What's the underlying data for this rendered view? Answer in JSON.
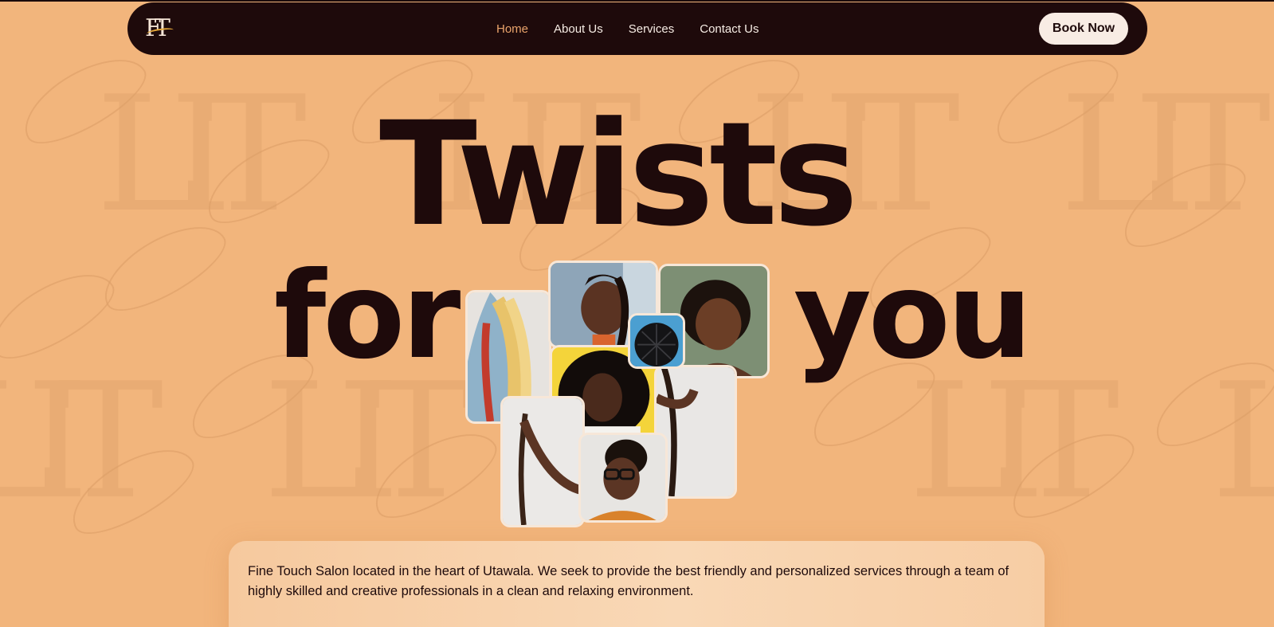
{
  "app": {
    "logo_text": "FT",
    "brand_colors": {
      "background": "#f2b57c",
      "nav": "#1e0a0b",
      "accent": "#e9a36b",
      "button_bg": "#f8ece4"
    }
  },
  "nav": {
    "links": [
      {
        "label": "Home",
        "active": true
      },
      {
        "label": "About Us",
        "active": false
      },
      {
        "label": "Services",
        "active": false
      },
      {
        "label": "Contact Us",
        "active": false
      }
    ],
    "book_label": "Book Now"
  },
  "hero": {
    "word_1": "Twists",
    "word_2": "for",
    "word_3": "you"
  },
  "intro": {
    "text": "Fine Touch Salon located in the heart of Utawala. We seek to provide the best friendly and personalized services through a team of highly skilled and creative professionals in a clean and relaxing environment."
  }
}
